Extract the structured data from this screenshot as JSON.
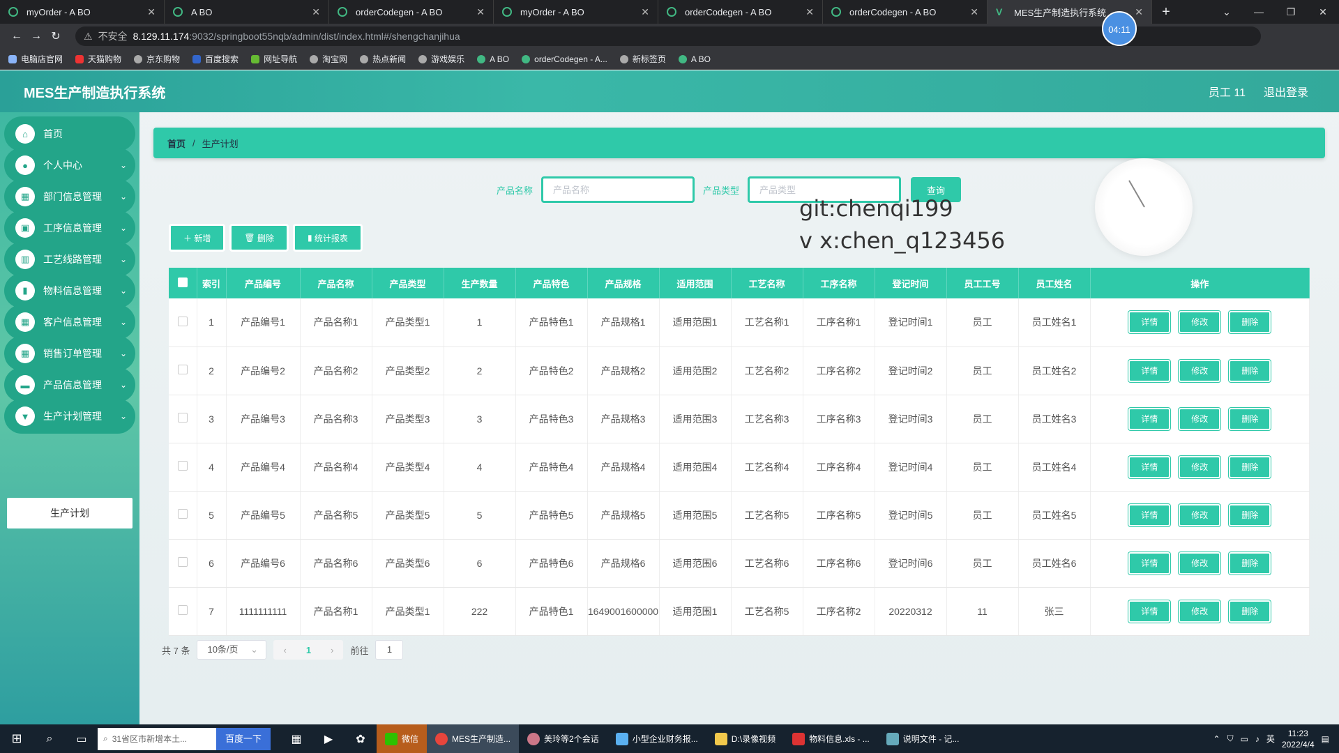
{
  "browser": {
    "tabs": [
      {
        "title": "myOrder - A BO"
      },
      {
        "title": "A BO"
      },
      {
        "title": "orderCodegen - A BO"
      },
      {
        "title": "myOrder - A BO"
      },
      {
        "title": "orderCodegen - A BO"
      },
      {
        "title": "orderCodegen - A BO"
      },
      {
        "title": "MES生产制造执行系统"
      }
    ],
    "recording_time": "04:11",
    "security_label": "不安全",
    "url_host": "8.129.11.174",
    "url_path": ":9032/springboot55nqb/admin/dist/index.html#/shengchanjihua",
    "bookmarks": [
      "电脑店官网",
      "天猫购物",
      "京东购物",
      "百度搜索",
      "网址导航",
      "淘宝网",
      "热点新闻",
      "游戏娱乐",
      "A BO",
      "orderCodegen - A...",
      "新标签页",
      "A BO"
    ]
  },
  "app": {
    "brand": "MES生产制造执行系统",
    "user": "员工 11",
    "logout": "退出登录"
  },
  "sidebar": {
    "items": [
      {
        "label": "首页",
        "icon": "home-icon"
      },
      {
        "label": "个人中心",
        "icon": "user-icon"
      },
      {
        "label": "部门信息管理",
        "icon": "grid-icon"
      },
      {
        "label": "工序信息管理",
        "icon": "briefcase-icon"
      },
      {
        "label": "工艺线路管理",
        "icon": "book-icon"
      },
      {
        "label": "物料信息管理",
        "icon": "bar-chart-icon"
      },
      {
        "label": "客户信息管理",
        "icon": "grid-icon"
      },
      {
        "label": "销售订单管理",
        "icon": "grid-icon"
      },
      {
        "label": "产品信息管理",
        "icon": "monitor-icon"
      },
      {
        "label": "生产计划管理",
        "icon": "trophy-icon"
      }
    ],
    "submenu": "生产计划"
  },
  "breadcrumb": {
    "home": "首页",
    "sep": "/",
    "current": "生产计划"
  },
  "search": {
    "name_label": "产品名称",
    "name_placeholder": "产品名称",
    "type_label": "产品类型",
    "type_placeholder": "产品类型",
    "query_button": "查询"
  },
  "watermark": {
    "line1": "git:chenqi199",
    "line2": "v x:chen_q123456"
  },
  "actions": {
    "add": "新增",
    "delete": "删除",
    "stats": "统计报表"
  },
  "table": {
    "headers": [
      "索引",
      "产品编号",
      "产品名称",
      "产品类型",
      "生产数量",
      "产品特色",
      "产品规格",
      "适用范围",
      "工艺名称",
      "工序名称",
      "登记时间",
      "员工工号",
      "员工姓名",
      "操作"
    ],
    "rows": [
      [
        "1",
        "产品编号1",
        "产品名称1",
        "产品类型1",
        "1",
        "产品特色1",
        "产品规格1",
        "适用范围1",
        "工艺名称1",
        "工序名称1",
        "登记时间1",
        "员工",
        "员工姓名1"
      ],
      [
        "2",
        "产品编号2",
        "产品名称2",
        "产品类型2",
        "2",
        "产品特色2",
        "产品规格2",
        "适用范围2",
        "工艺名称2",
        "工序名称2",
        "登记时间2",
        "员工",
        "员工姓名2"
      ],
      [
        "3",
        "产品编号3",
        "产品名称3",
        "产品类型3",
        "3",
        "产品特色3",
        "产品规格3",
        "适用范围3",
        "工艺名称3",
        "工序名称3",
        "登记时间3",
        "员工",
        "员工姓名3"
      ],
      [
        "4",
        "产品编号4",
        "产品名称4",
        "产品类型4",
        "4",
        "产品特色4",
        "产品规格4",
        "适用范围4",
        "工艺名称4",
        "工序名称4",
        "登记时间4",
        "员工",
        "员工姓名4"
      ],
      [
        "5",
        "产品编号5",
        "产品名称5",
        "产品类型5",
        "5",
        "产品特色5",
        "产品规格5",
        "适用范围5",
        "工艺名称5",
        "工序名称5",
        "登记时间5",
        "员工",
        "员工姓名5"
      ],
      [
        "6",
        "产品编号6",
        "产品名称6",
        "产品类型6",
        "6",
        "产品特色6",
        "产品规格6",
        "适用范围6",
        "工艺名称6",
        "工序名称6",
        "登记时间6",
        "员工",
        "员工姓名6"
      ],
      [
        "7",
        "1111111111",
        "产品名称1",
        "产品类型1",
        "222",
        "产品特色1",
        "1649001600000",
        "适用范围1",
        "工艺名称5",
        "工序名称2",
        "20220312",
        "11",
        "张三"
      ]
    ],
    "row_actions": {
      "detail": "详情",
      "edit": "修改",
      "delete": "删除"
    }
  },
  "pager": {
    "total": "共 7 条",
    "page_size": "10条/页",
    "current": "1",
    "goto": "前往",
    "goto_value": "1"
  },
  "taskbar": {
    "search_placeholder": "31省区市新增本土...",
    "search_button": "百度一下",
    "apps": [
      "微信",
      "MES生产制造...",
      "美玲等2个会话",
      "小型企业财务报...",
      "D:\\录像视频",
      "物料信息.xls - ...",
      "说明文件 - 记..."
    ],
    "ime": "英",
    "time": "11:23",
    "date": "2022/4/4"
  },
  "colors": {
    "accent": "#2fc9a9",
    "sidebar_item": "#23a589",
    "header": "#33a99b"
  }
}
